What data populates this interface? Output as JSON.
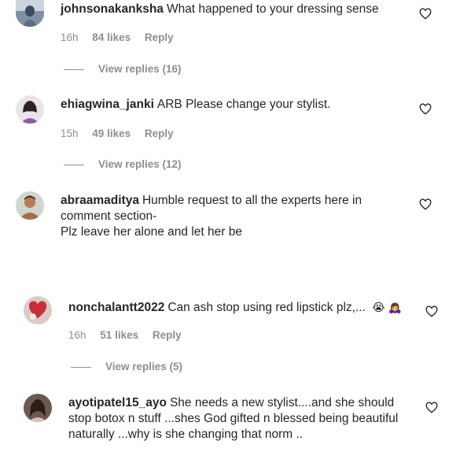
{
  "comments": [
    {
      "username": "johnsonakanksha",
      "text": "What happened to your dressing sense",
      "time": "16h",
      "likes": "84 likes",
      "reply": "Reply",
      "view_replies": "View replies (16)"
    },
    {
      "username": "ehiagwina_janki",
      "text": "ARB Please change your stylist.",
      "time": "15h",
      "likes": "49 likes",
      "reply": "Reply",
      "view_replies": "View replies (12)"
    },
    {
      "username": "abraamaditya",
      "text": "Humble request to all the experts here in comment section-",
      "text2": "Plz leave her alone and let her be"
    },
    {
      "username": "nonchalantt2022",
      "text": "Can ash stop using red lipstick plz,...",
      "emojis": [
        "😭",
        "🙇‍♀️"
      ],
      "time": "16h",
      "likes": "51 likes",
      "reply": "Reply",
      "view_replies": "View replies (5)"
    },
    {
      "username": "ayotipatel15_ayo",
      "text": "She needs a new stylist....and she should stop botox n stuff ...shes God gifted n blessed being beautiful naturally ...why is she changing that norm .."
    }
  ],
  "icons": {
    "like": "heart-outline-icon"
  },
  "colors": {
    "text": "#262626",
    "muted": "#8e8e8e"
  }
}
